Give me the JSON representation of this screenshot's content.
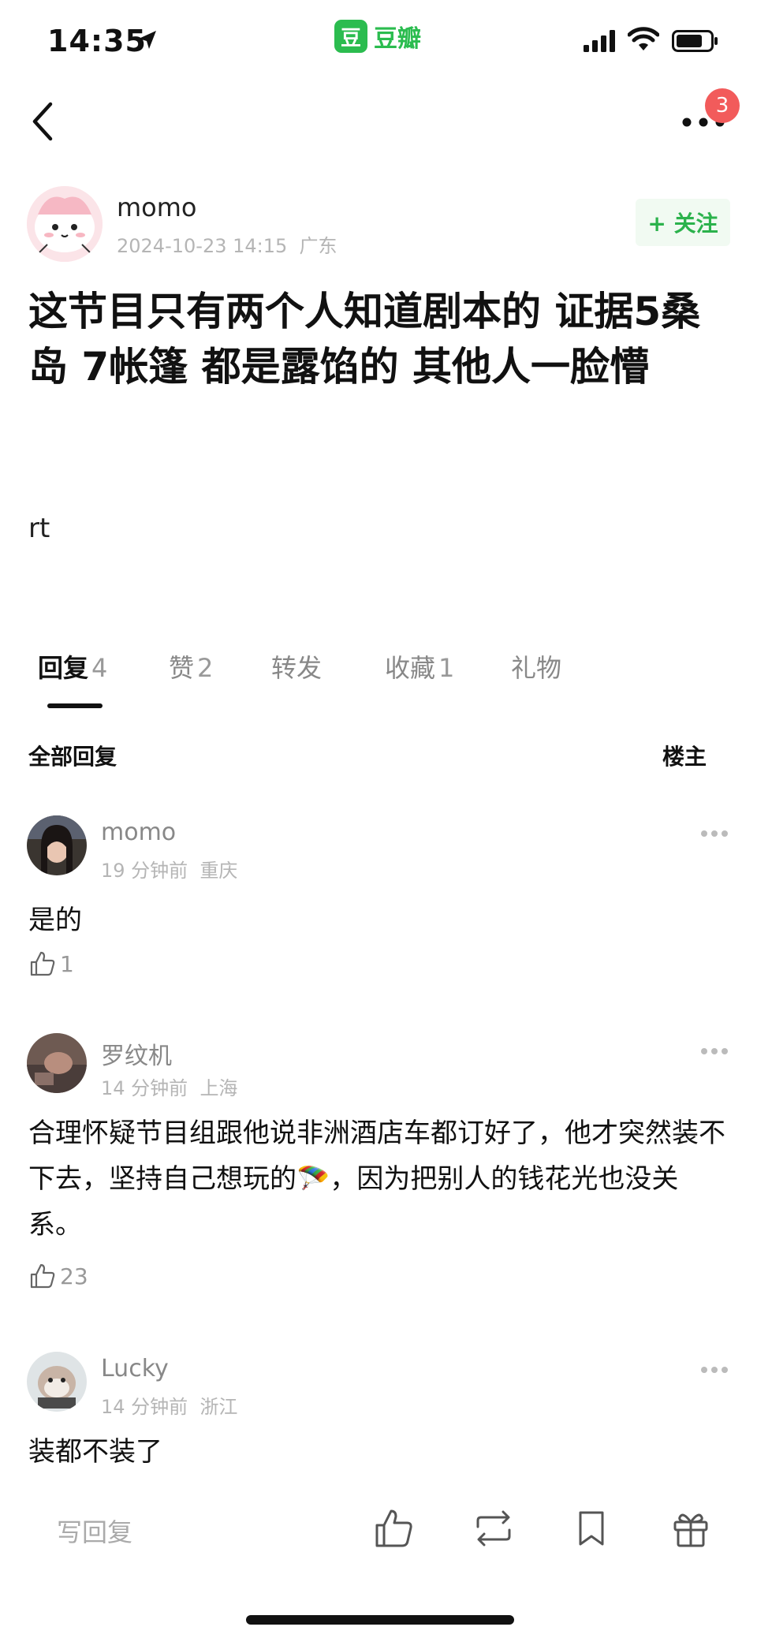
{
  "status_bar": {
    "time": "14:35",
    "app_logo": "豆",
    "app_name": "豆瓣"
  },
  "nav": {
    "notification_count": "3"
  },
  "post": {
    "author": "momo",
    "datetime": "2024-10-23 14:15",
    "location": "广东",
    "follow_label": "+ 关注",
    "title": "这节目只有两个人知道剧本的 证据5桑岛 7帐篷 都是露馅的 其他人一脸懵",
    "body": "rt"
  },
  "tabs": [
    {
      "label": "回复",
      "count": "4"
    },
    {
      "label": "赞",
      "count": "2"
    },
    {
      "label": "转发",
      "count": ""
    },
    {
      "label": "收藏",
      "count": "1"
    },
    {
      "label": "礼物",
      "count": ""
    }
  ],
  "filter": {
    "all": "全部回复",
    "op": "楼主"
  },
  "comments": [
    {
      "name": "momo",
      "time": "19 分钟前",
      "location": "重庆",
      "text": "是的",
      "likes": "1"
    },
    {
      "name": "罗纹机",
      "time": "14 分钟前",
      "location": "上海",
      "text": "合理怀疑节目组跟他说非洲酒店车都订好了，他才突然装不下去，坚持自己想玩的🪂，因为把别人的钱花光也没关系。",
      "likes": "23"
    },
    {
      "name": "Lucky",
      "time": "14 分钟前",
      "location": "浙江",
      "text": "装都不装了",
      "likes": ""
    }
  ],
  "bottom_bar": {
    "reply_placeholder": "写回复",
    "icons": [
      "thumbs-up-icon",
      "repost-icon",
      "bookmark-icon",
      "gift-icon"
    ]
  },
  "colors": {
    "brand_green": "#2bbc4f",
    "badge_red": "#f25b5b"
  }
}
